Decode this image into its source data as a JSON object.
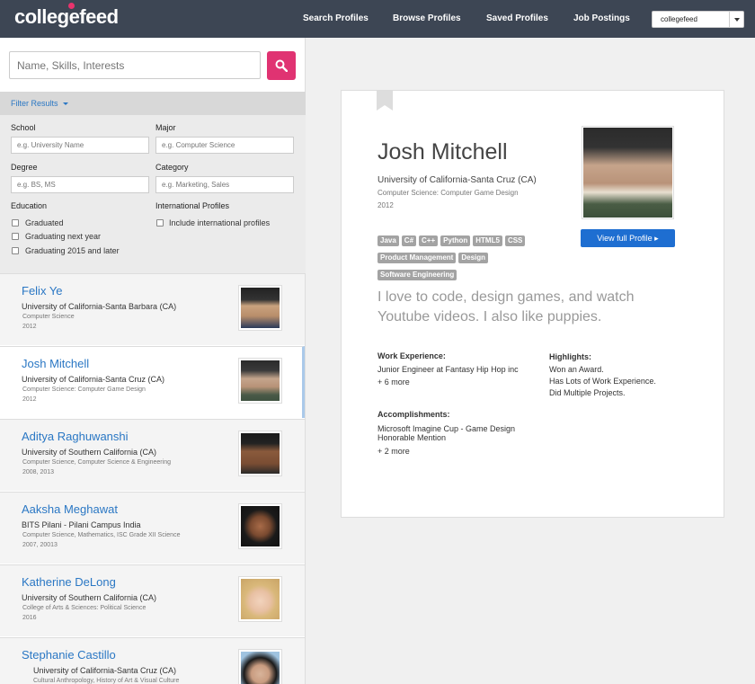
{
  "header": {
    "logo": "collegefeed",
    "nav": [
      "Search Profiles",
      "Browse Profiles",
      "Saved Profiles",
      "Job Postings"
    ],
    "account": "collegefeed"
  },
  "search": {
    "placeholder": "Name, Skills, Interests"
  },
  "filters": {
    "title": "Filter Results",
    "school_label": "School",
    "school_placeholder": "e.g. University Name",
    "major_label": "Major",
    "major_placeholder": "e.g. Computer Science",
    "degree_label": "Degree",
    "degree_placeholder": "e.g. BS, MS",
    "category_label": "Category",
    "category_placeholder": "e.g. Marketing, Sales",
    "education_label": "Education",
    "education_options": [
      "Graduated",
      "Graduating next year",
      "Graduating 2015 and later"
    ],
    "intl_label": "International Profiles",
    "intl_option": "Include international profiles"
  },
  "results": [
    {
      "name": "Felix Ye",
      "school": "University of California-Santa Barbara (CA)",
      "major": "Computer Science",
      "year": "2012"
    },
    {
      "name": "Josh Mitchell",
      "school": "University of California-Santa Cruz  (CA)",
      "major": "Computer Science: Computer Game Design",
      "year": "2012"
    },
    {
      "name": "Aditya Raghuwanshi",
      "school": "University of Southern California (CA)",
      "major": "Computer Science, Computer Science & Engineering",
      "year": "2008, 2013"
    },
    {
      "name": "Aaksha Meghawat",
      "school": "BITS Pilani - Pilani Campus India",
      "major": "Computer Science, Mathematics, ISC Grade XII Science",
      "year": "2007, 20013"
    },
    {
      "name": "Katherine DeLong",
      "school": "University of Southern California (CA)",
      "major": "College of Arts & Sciences: Political Science",
      "year": "2016"
    },
    {
      "name": "Stephanie Castillo",
      "school": "University of California-Santa Cruz (CA)",
      "major": "Cultural Anthropology, History of Art & Visual Culture",
      "year": ""
    }
  ],
  "profile": {
    "name": "Josh Mitchell",
    "school": "University of California-Santa Cruz (CA)",
    "major": "Computer Science: Computer Game Design",
    "year": "2012",
    "tags": [
      "Java",
      "C#",
      "C++",
      "Python",
      "HTML5",
      "CSS",
      "Product Management",
      "Design",
      "Software Engineering"
    ],
    "view_button": "View full Profile",
    "quote": "I love to code, design games, and watch Youtube videos. I also like puppies.",
    "work_heading": "Work Experience:",
    "work_line": "Junior Engineer at Fantasy Hip Hop inc",
    "work_more": "+ 6 more",
    "highlights_heading": "Highlights:",
    "highlights": [
      "Won an Award.",
      "Has Lots of Work Experience.",
      "Did Multiple Projects."
    ],
    "acc_heading": "Accomplishments:",
    "acc_line1": "Microsoft Imagine Cup - Game Design",
    "acc_line2": "Honorable Mention",
    "acc_more": "+ 2 more"
  }
}
